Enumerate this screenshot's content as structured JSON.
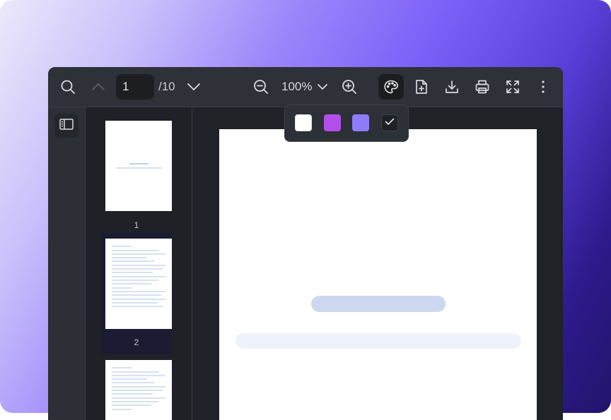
{
  "toolbar": {
    "search_icon": "search-icon",
    "prev_icon": "chevron-up-icon",
    "page_number": "1",
    "page_total": "/10",
    "next_icon": "chevron-down-icon",
    "zoom_out_icon": "zoom-out-icon",
    "zoom_value": "100%",
    "zoom_dropdown_icon": "chevron-down-icon",
    "zoom_in_icon": "zoom-in-icon",
    "theme_icon": "palette-icon",
    "add_page_icon": "file-plus-icon",
    "download_icon": "download-icon",
    "print_icon": "printer-icon",
    "fullscreen_icon": "fullscreen-icon",
    "more_icon": "more-vertical-icon"
  },
  "sidebar": {
    "toggle_icon": "sidebar-toggle-icon"
  },
  "thumbnails": [
    {
      "label": "1"
    },
    {
      "label": "2"
    }
  ],
  "theme_popover": {
    "swatches": [
      {
        "name": "white",
        "color": "#FFFFFF"
      },
      {
        "name": "purple",
        "color": "#B44EEB"
      },
      {
        "name": "lavender",
        "color": "#8C7CF8"
      },
      {
        "name": "dark",
        "color": "#1F2126",
        "selected": true
      }
    ],
    "check_icon": "check-icon"
  },
  "colors": {
    "accent": "#7A5FF7",
    "toolbar_bg": "#2E3137",
    "viewer_bg": "#1F2227"
  }
}
